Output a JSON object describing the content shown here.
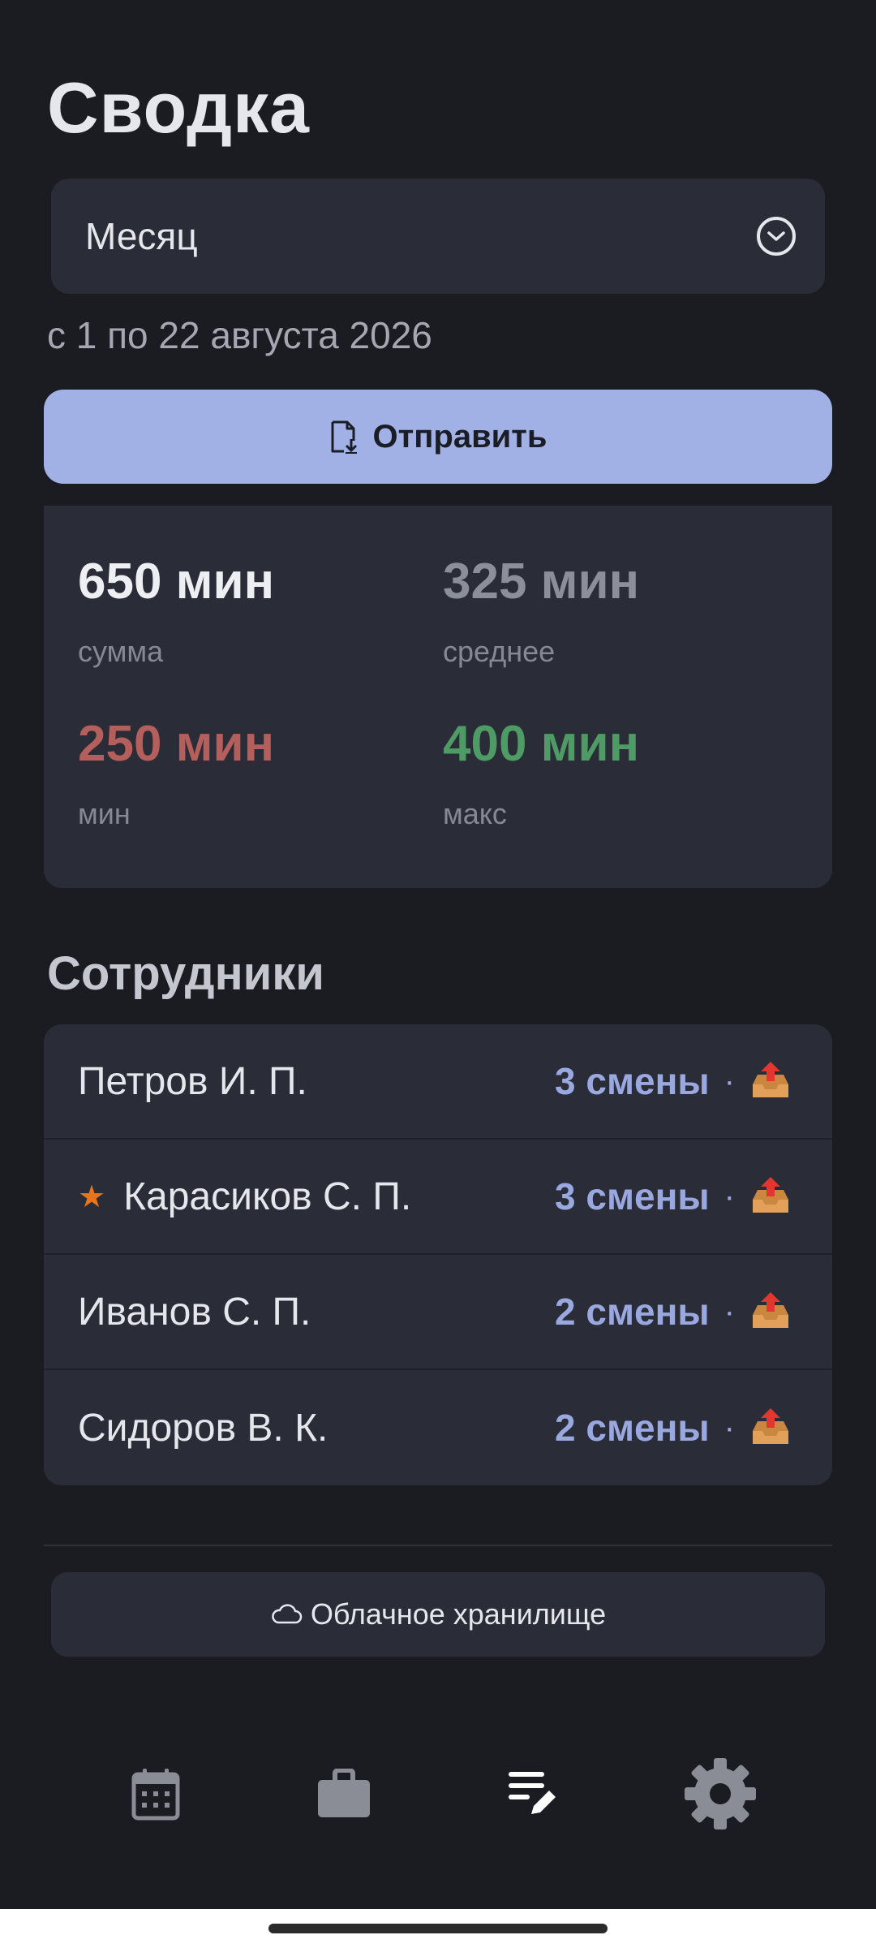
{
  "header": {
    "title": "Сводка"
  },
  "period_select": {
    "value": "Месяц",
    "icon": "chevron-down-circle-icon"
  },
  "period_text": "с 1 по 22 августа 2026",
  "send_button": {
    "label": "Отправить",
    "icon": "document-download-icon"
  },
  "stats": [
    {
      "value": "650 мин",
      "label": "сумма",
      "color": "#eeeff3"
    },
    {
      "value": "325 мин",
      "label": "среднее",
      "color": "#8b8f99"
    },
    {
      "value": "250 мин",
      "label": "мин",
      "color": "#b45f5c"
    },
    {
      "value": "400 мин",
      "label": "макс",
      "color": "#4f9b65"
    }
  ],
  "employees": {
    "title": "Сотрудники",
    "rows": [
      {
        "name": "Петров И. П.",
        "shifts": "3 смены",
        "starred": false,
        "icon": "outbox-tray-icon"
      },
      {
        "name": "Карасиков С. П.",
        "shifts": "3 смены",
        "starred": true,
        "icon": "outbox-tray-icon"
      },
      {
        "name": "Иванов С. П.",
        "shifts": "2 смены",
        "starred": false,
        "icon": "outbox-tray-icon"
      },
      {
        "name": "Сидоров В. К.",
        "shifts": "2 смены",
        "starred": false,
        "icon": "outbox-tray-icon"
      }
    ]
  },
  "cloud_button": {
    "label": "Облачное хранилище",
    "icon": "cloud-icon"
  },
  "bottom_nav": [
    {
      "name": "calendar-icon",
      "active": false
    },
    {
      "name": "briefcase-icon",
      "active": false
    },
    {
      "name": "report-edit-icon",
      "active": true
    },
    {
      "name": "settings-gear-icon",
      "active": false
    }
  ],
  "colors": {
    "background": "#1b1c21",
    "card": "#2a2d37",
    "accent": "#a1b1e6",
    "star": "#e8741b"
  }
}
